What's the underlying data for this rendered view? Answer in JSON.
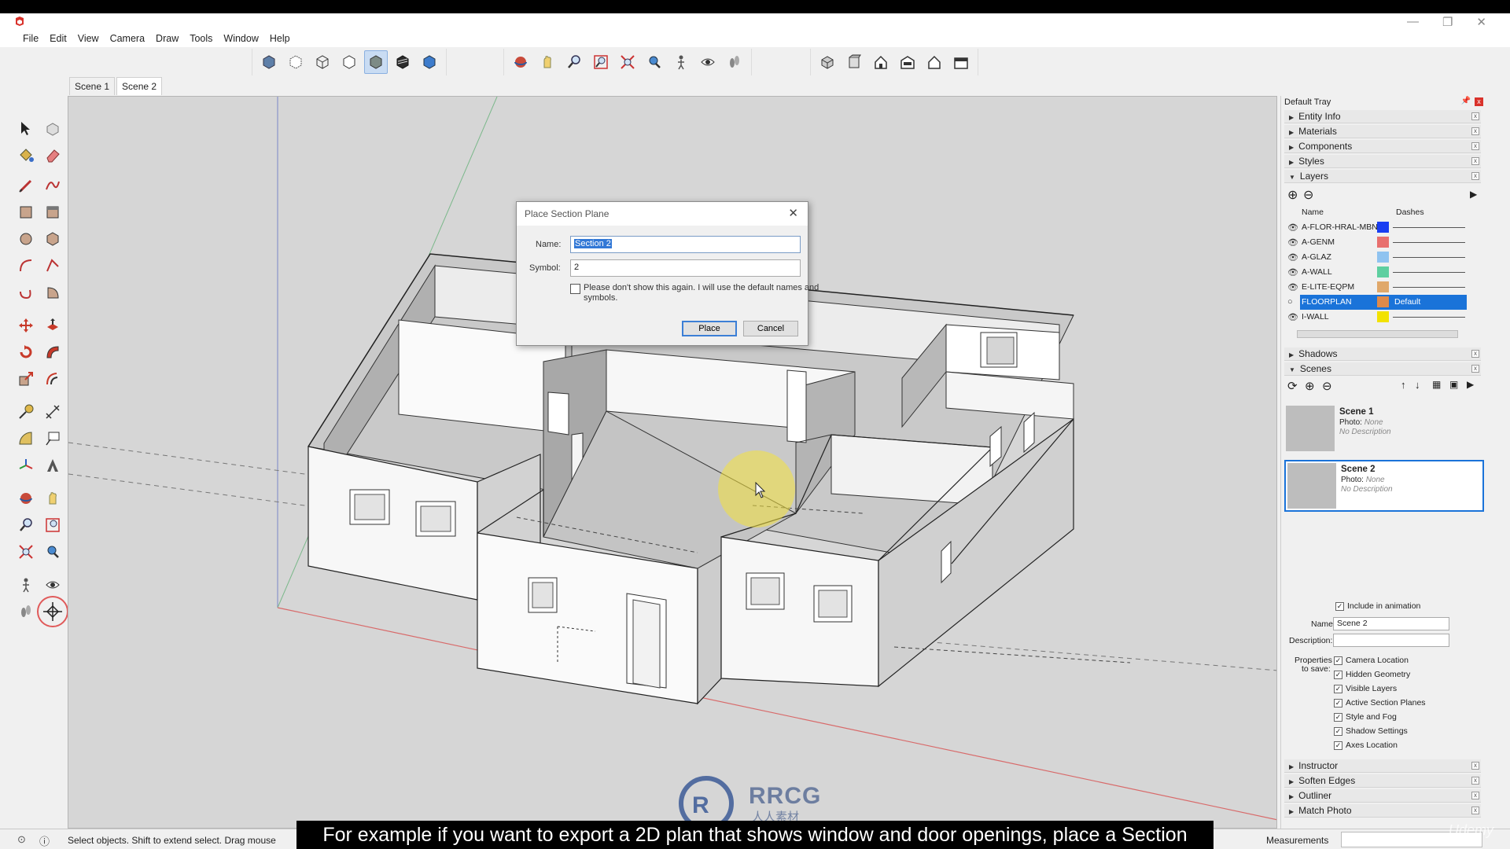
{
  "window": {
    "app_icon": "sketchup-logo-icon",
    "controls": [
      "minimize-icon",
      "restore-icon",
      "close-icon"
    ]
  },
  "menu": [
    "File",
    "Edit",
    "View",
    "Camera",
    "Draw",
    "Tools",
    "Window",
    "Help"
  ],
  "scene_tabs": [
    "Scene 1",
    "Scene 2"
  ],
  "dialog": {
    "title": "Place Section Plane",
    "name_label": "Name:",
    "name_value": "Section 2",
    "symbol_label": "Symbol:",
    "symbol_value": "2",
    "checkbox_note": "Please don't show this again.  I will use the default names and symbols.",
    "place_label": "Place",
    "cancel_label": "Cancel"
  },
  "tray": {
    "title": "Default Tray",
    "panels_top": [
      "Entity Info",
      "Materials",
      "Components",
      "Styles",
      "Layers"
    ],
    "layers_columns": [
      "Name",
      "Dashes"
    ],
    "layers": [
      {
        "name": "A-FLOR-HRAL-MBN",
        "color": "#1a3ef2",
        "dashes": ""
      },
      {
        "name": "A-GENM",
        "color": "#e8706e",
        "dashes": ""
      },
      {
        "name": "A-GLAZ",
        "color": "#8fc3f0",
        "dashes": ""
      },
      {
        "name": "A-WALL",
        "color": "#5ecfa0",
        "dashes": ""
      },
      {
        "name": "E-LITE-EQPM",
        "color": "#e0a86a",
        "dashes": ""
      },
      {
        "name": "FLOORPLAN",
        "color": "#e08a4a",
        "dashes": "Default"
      },
      {
        "name": "I-WALL",
        "color": "#f2e200",
        "dashes": ""
      }
    ],
    "panels_mid": [
      "Shadows",
      "Scenes"
    ],
    "scenes": [
      {
        "title": "Scene 1",
        "photo_label": "Photo:",
        "photo_value": "None",
        "description": "No Description"
      },
      {
        "title": "Scene 2",
        "photo_label": "Photo:",
        "photo_value": "None",
        "description": "No Description"
      }
    ],
    "scene_props": {
      "include_animation": "Include in animation",
      "name_label": "Name:",
      "name_value": "Scene 2",
      "description_label": "Description:",
      "properties_label_1": "Properties",
      "properties_label_2": "to save:",
      "checkboxes": [
        "Camera Location",
        "Hidden Geometry",
        "Visible Layers",
        "Active Section Planes",
        "Style and Fog",
        "Shadow Settings",
        "Axes Location"
      ]
    },
    "panels_bottom": [
      "Instructor",
      "Soften Edges",
      "Outliner",
      "Match Photo"
    ]
  },
  "status": {
    "hint": "Select objects. Shift to extend select. Drag mouse",
    "measurements_label": "Measurements"
  },
  "subtitle": "For example if you want to export a 2D plan that shows window and door openings, place a Section",
  "watermark": {
    "brand": "RRCG",
    "sub": "人人素材"
  },
  "udemy": "Udemy"
}
